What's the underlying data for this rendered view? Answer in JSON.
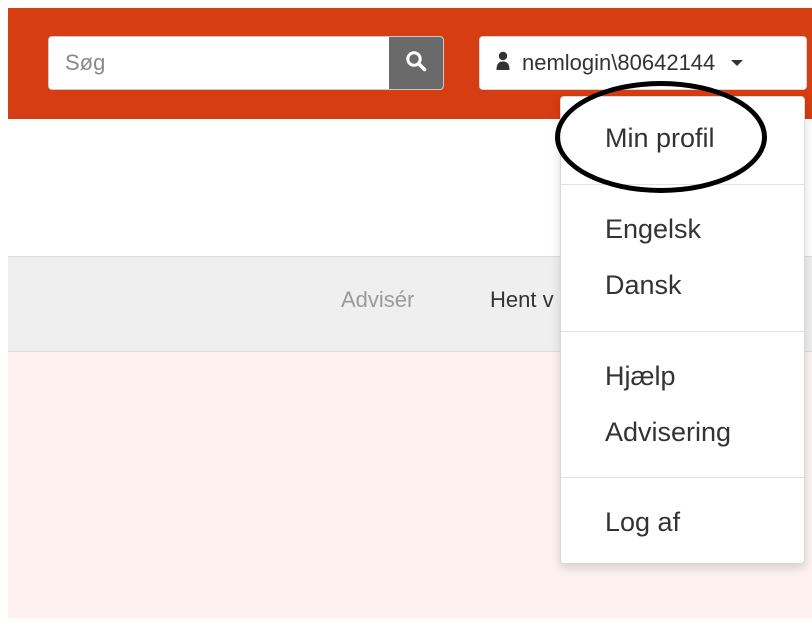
{
  "colors": {
    "topbar": "#d73d12",
    "search_button": "#6a6a6a",
    "nav_strip": "#efefef",
    "content_background": "#fdf2f0"
  },
  "search": {
    "placeholder": "Søg",
    "button_icon": "search-icon"
  },
  "user_menu": {
    "icon": "user-icon",
    "username": "nemlogin\\80642144",
    "caret_icon": "caret-down-icon"
  },
  "nav": {
    "items": [
      {
        "label": "Advisér",
        "state": "disabled"
      },
      {
        "label": "Hent v"
      }
    ]
  },
  "dropdown": {
    "groups": [
      [
        {
          "label": "Min profil",
          "highlighted": true
        }
      ],
      [
        {
          "label": "Engelsk"
        },
        {
          "label": "Dansk"
        }
      ],
      [
        {
          "label": "Hjælp"
        },
        {
          "label": "Advisering"
        }
      ],
      [
        {
          "label": "Log af"
        }
      ]
    ]
  }
}
